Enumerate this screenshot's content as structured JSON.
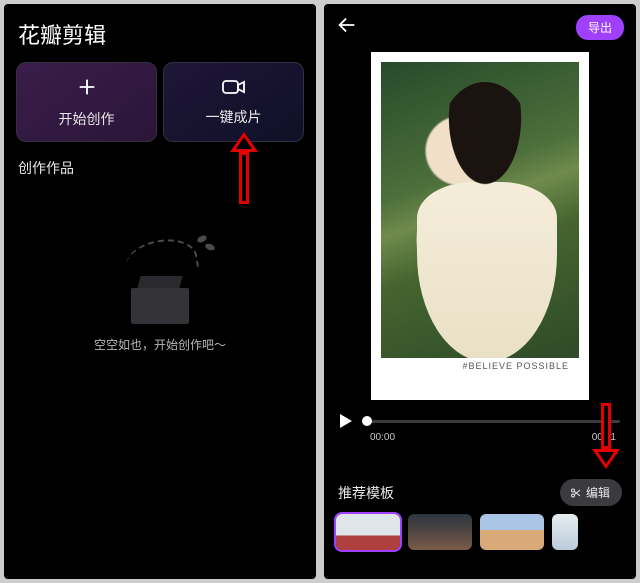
{
  "left": {
    "app_title": "花瓣剪辑",
    "create_action": {
      "label": "开始创作",
      "icon": "plus-icon"
    },
    "autocut_action": {
      "label": "一键成片",
      "icon": "video-camera-icon"
    },
    "gallery_label": "创作作品",
    "empty_state_text": "空空如也，开始创作吧～"
  },
  "right": {
    "export_label": "导出",
    "preview_caption": "#BELIEVE POSSIBLE",
    "player": {
      "current_time": "00:00",
      "total_time": "00:11"
    },
    "templates_label": "推荐模板",
    "edit_chip_label": "编辑",
    "templates": [
      {
        "name": "template-1",
        "selected": true
      },
      {
        "name": "template-2",
        "selected": false
      },
      {
        "name": "template-3",
        "selected": false
      },
      {
        "name": "template-4",
        "selected": false
      }
    ]
  },
  "annotations": {
    "arrow_left": "points-to-autocut-action",
    "arrow_right": "points-to-edit-chip"
  }
}
